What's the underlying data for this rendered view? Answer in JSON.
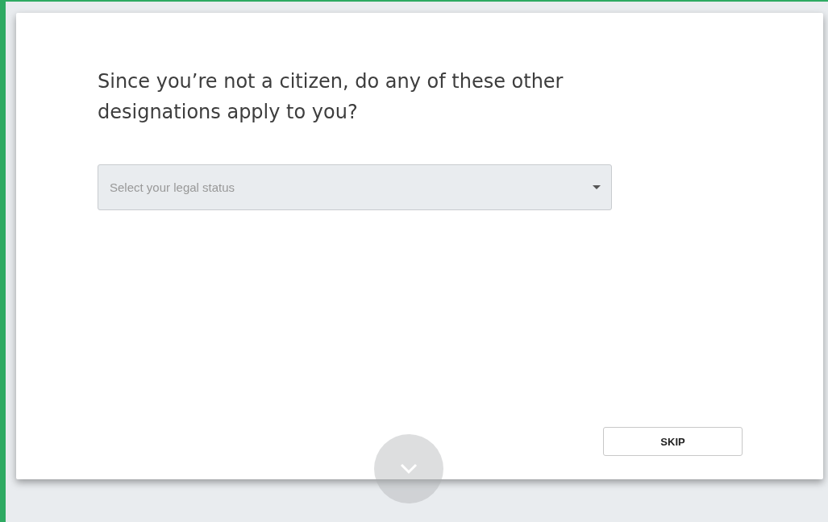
{
  "question": {
    "title": "Since you’re not a citizen, do any of these other designations apply to you?"
  },
  "legal_status_select": {
    "placeholder": "Select your legal status"
  },
  "skip_button": {
    "label": "SKIP"
  }
}
